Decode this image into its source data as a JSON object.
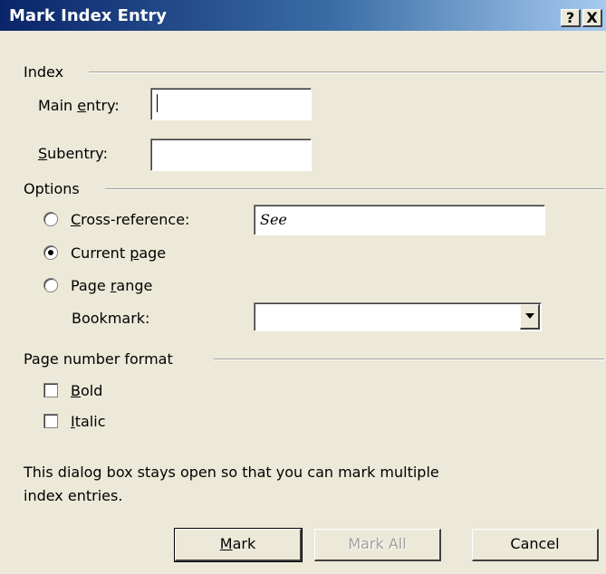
{
  "window": {
    "title": "Mark Index Entry",
    "help_button": "?",
    "close_button": "X"
  },
  "index_group": {
    "label": "Index",
    "main_entry": {
      "label_pre": "Main ",
      "label_key": "e",
      "label_post": "ntry:",
      "value": ""
    },
    "subentry": {
      "label_pre": "",
      "label_key": "S",
      "label_post": "ubentry:",
      "value": ""
    }
  },
  "options_group": {
    "label": "Options",
    "cross_reference": {
      "label_pre": "",
      "label_key": "C",
      "label_post": "ross-reference:",
      "value": "See",
      "selected": false
    },
    "current_page": {
      "label_pre": "Current ",
      "label_key": "p",
      "label_post": "age",
      "selected": true
    },
    "page_range": {
      "label_pre": "Page ",
      "label_key": "r",
      "label_post": "ange",
      "selected": false
    },
    "bookmark": {
      "label": "Bookmark:",
      "value": ""
    }
  },
  "page_number_format": {
    "label": "Page number format",
    "bold": {
      "label_pre": "",
      "label_key": "B",
      "label_post": "old",
      "checked": false
    },
    "italic": {
      "label_pre": "",
      "label_key": "I",
      "label_post": "talic",
      "checked": false
    }
  },
  "info_text_line1": "This dialog box stays open so that you can mark multiple",
  "info_text_line2": "index entries.",
  "buttons": {
    "mark": {
      "label_pre": "",
      "label_key": "M",
      "label_post": "ark"
    },
    "mark_all": {
      "label": "Mark All"
    },
    "cancel": {
      "label": "Cancel"
    }
  }
}
